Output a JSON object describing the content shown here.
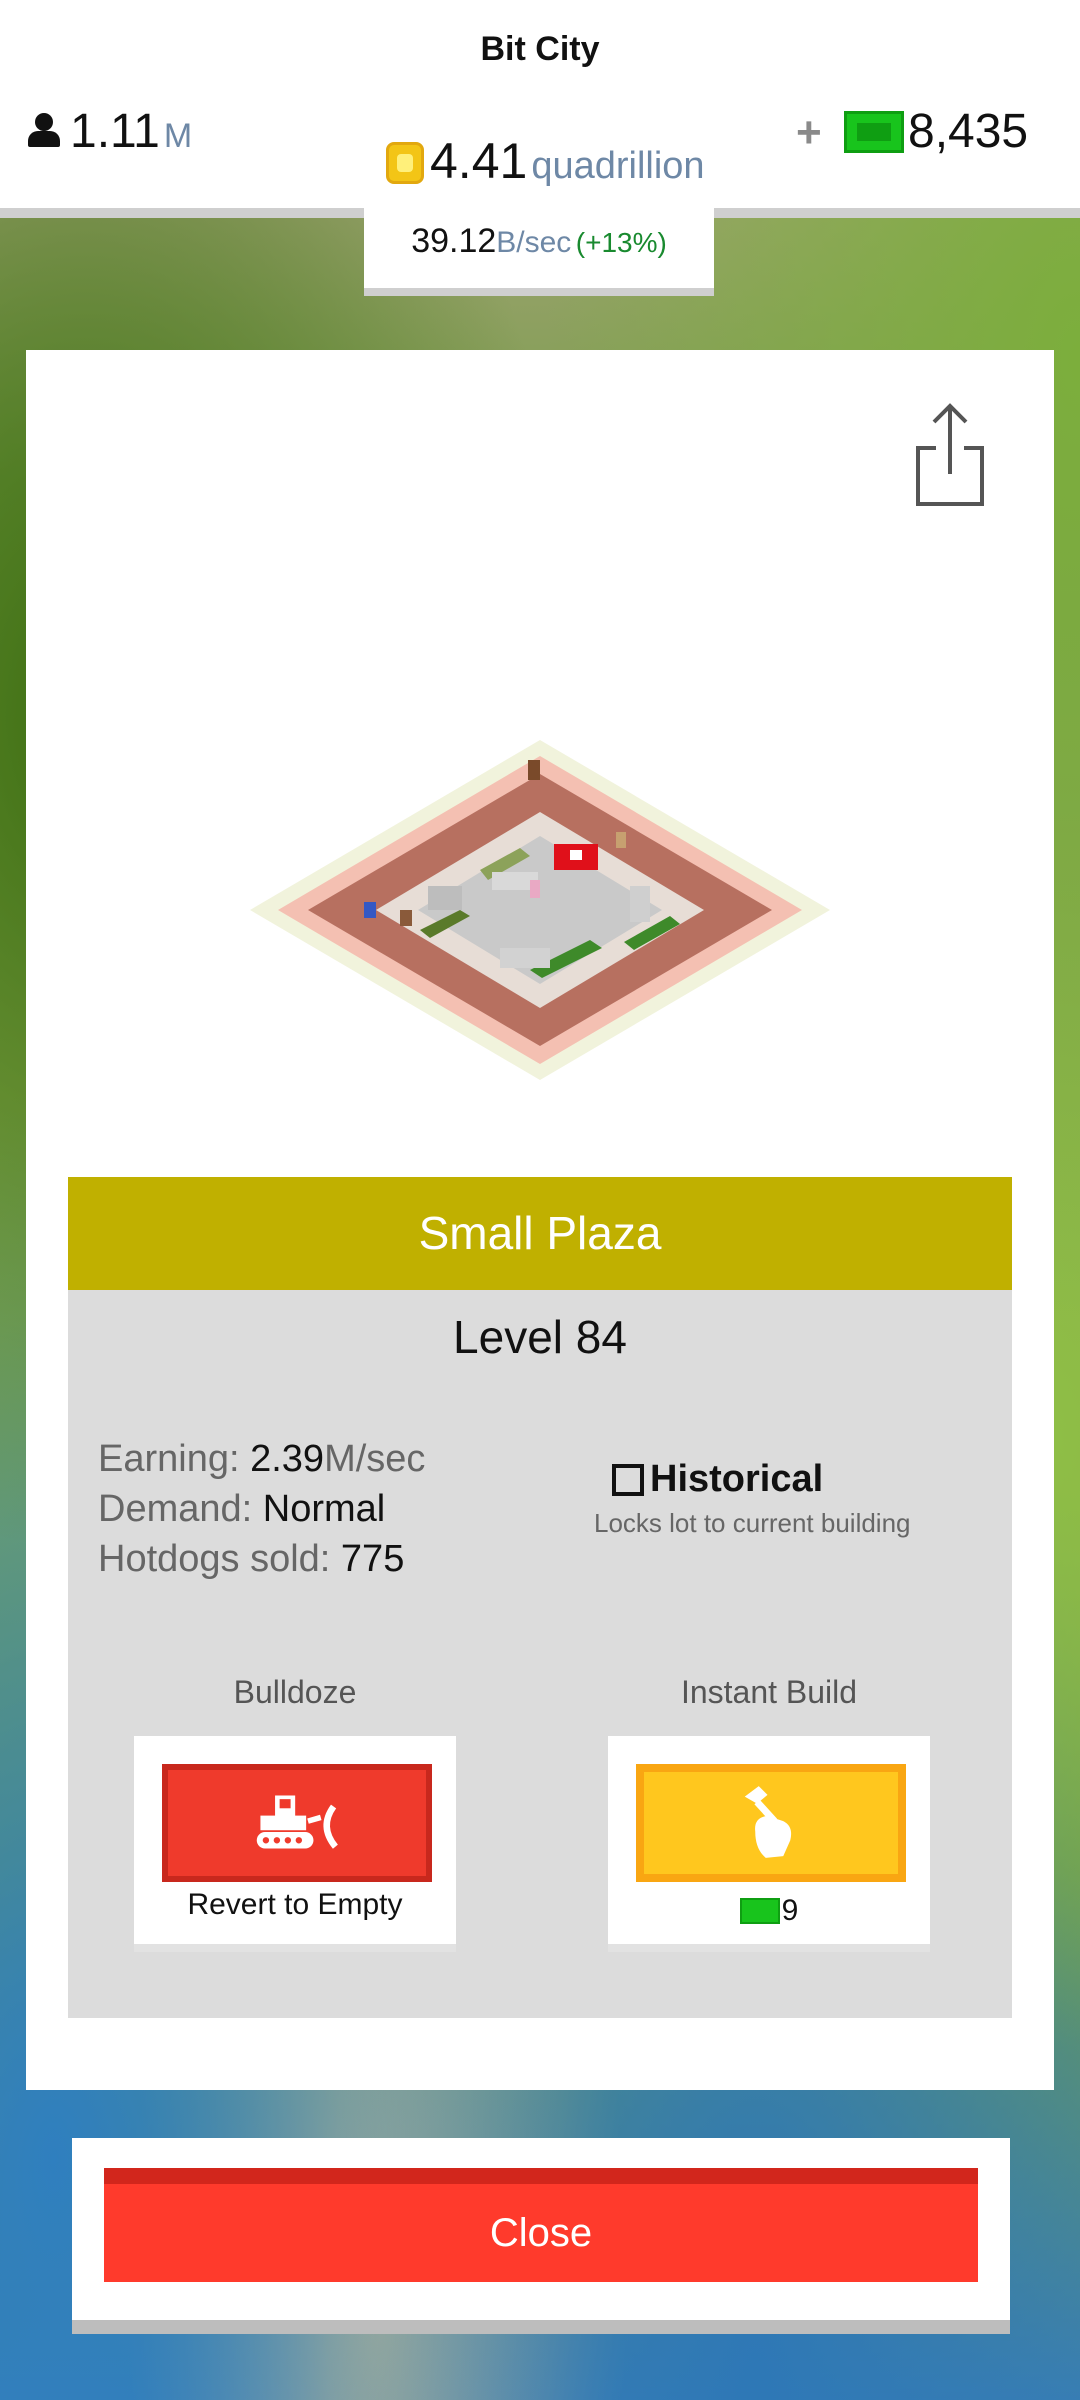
{
  "header": {
    "title": "Bit City",
    "population": {
      "value": "1.11",
      "unit": "M"
    },
    "coins": {
      "value": "4.41",
      "unit": "quadrillion"
    },
    "plus": "+",
    "cash": "8,435",
    "rate": {
      "value": "39.12",
      "unit": "B/sec",
      "bonus": "(+13%)"
    }
  },
  "building": {
    "name": "Small Plaza",
    "level": "Level 84",
    "earning_label": "Earning: ",
    "earning_value": "2.39",
    "earning_unit": "M/sec",
    "demand_label": "Demand: ",
    "demand_value": "Normal",
    "hotdogs_label": "Hotdogs sold: ",
    "hotdogs_value": "775",
    "historical_label": "Historical",
    "historical_checked": false,
    "historical_desc": "Locks lot to current building"
  },
  "actions": {
    "bulldoze_label": "Bulldoze",
    "bulldoze_caption": "Revert to Empty",
    "instant_label": "Instant Build",
    "instant_cost": "9"
  },
  "close_label": "Close",
  "icons": {
    "population": "person-icon",
    "coins": "coin-icon",
    "cash": "cash-icon",
    "share": "share-icon",
    "bulldoze": "bulldozer-icon",
    "instant": "hammer-hand-icon"
  },
  "colors": {
    "name_bar": "#c0b000",
    "bulldoze_button": "#ef3a2c",
    "instant_button": "#ffc71e",
    "close_button": "#ff3a2c"
  }
}
